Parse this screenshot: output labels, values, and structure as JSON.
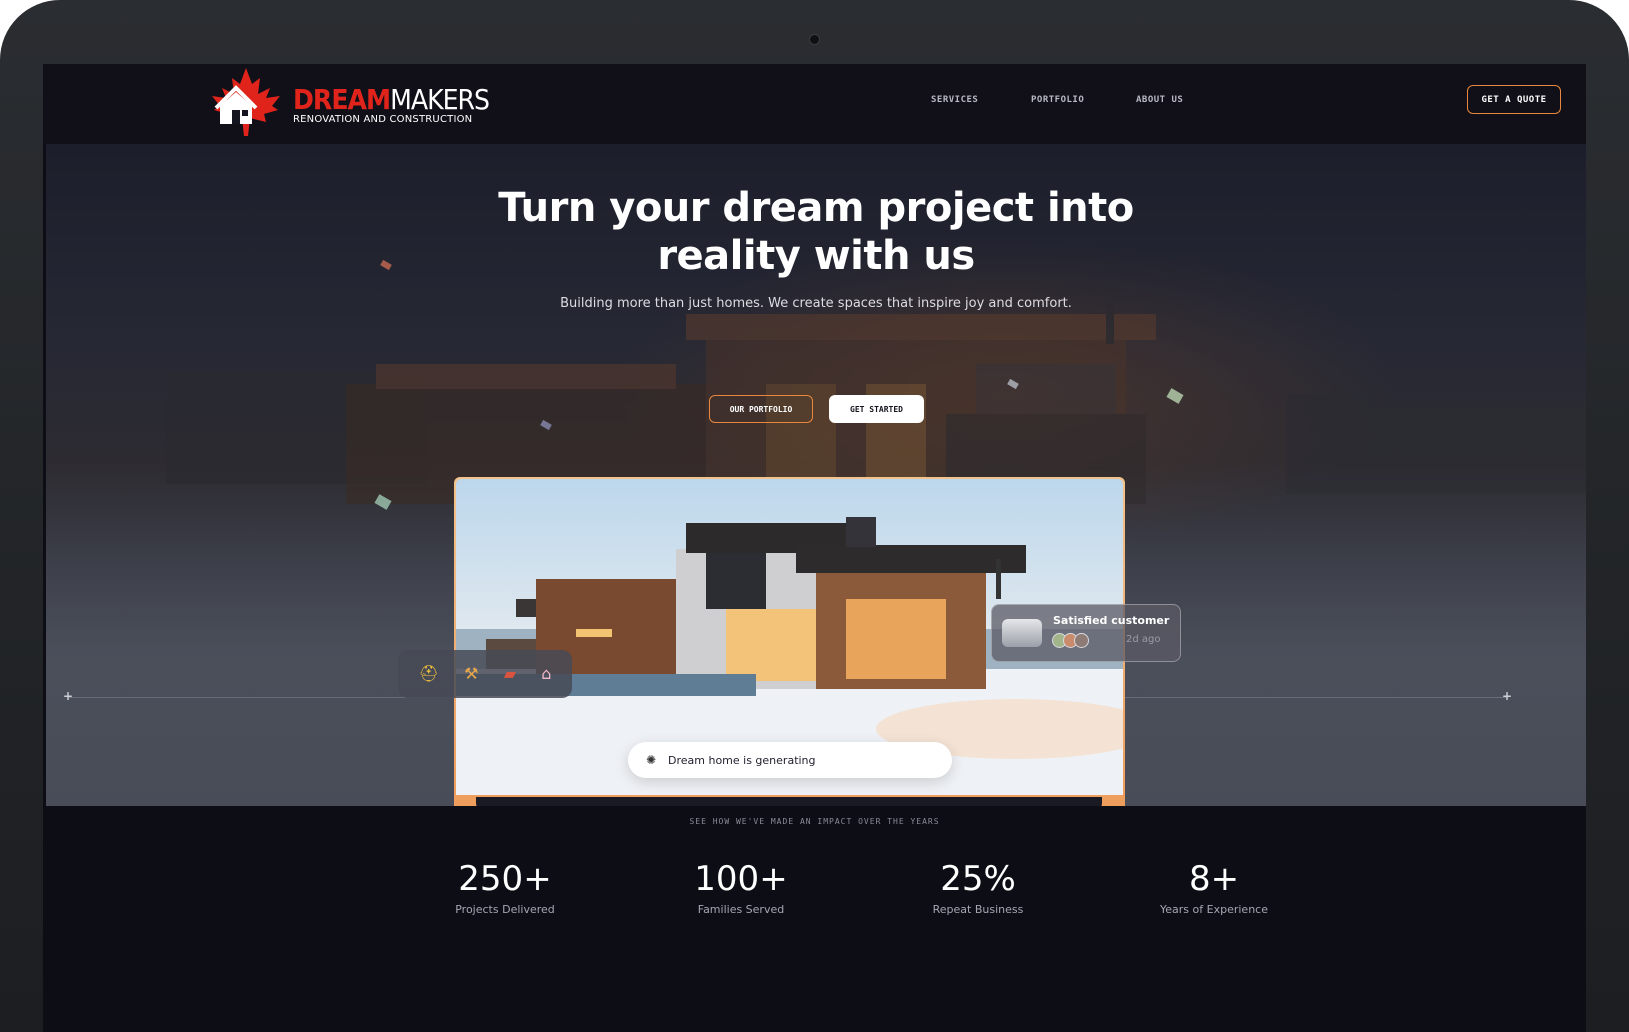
{
  "brand": {
    "name_part1": "DREAM",
    "name_part2": "MAKERS",
    "tagline": "RENOVATION AND CONSTRUCTION",
    "accent_color": "#e0241b",
    "cta_color": "#e8873d"
  },
  "nav": {
    "links": [
      "SERVICES",
      "PORTFOLIO",
      "ABOUT US"
    ],
    "cta": "GET A QUOTE"
  },
  "hero": {
    "title_line1": "Turn your dream project into",
    "title_line2": "reality  with  us",
    "subtitle": "Building more than just homes. We create spaces that inspire joy and comfort.",
    "btn_portfolio": "OUR PORTFOLIO",
    "btn_started": "GET STARTED"
  },
  "card": {
    "status_text": "Dream home is generating",
    "tool_icons": [
      "worker-icon",
      "hammer-icon",
      "brick-icon",
      "house-icon"
    ]
  },
  "review": {
    "title": "Satisfied customer",
    "time": "2d ago"
  },
  "stats": {
    "subtitle": "SEE HOW WE'VE MADE AN IMPACT OVER THE YEARS",
    "items": [
      {
        "value": "250+",
        "label": "Projects Delivered"
      },
      {
        "value": "100+",
        "label": "Families Served"
      },
      {
        "value": "25%",
        "label": "Repeat Business"
      },
      {
        "value": "8+",
        "label": "Years of Experience"
      }
    ]
  }
}
